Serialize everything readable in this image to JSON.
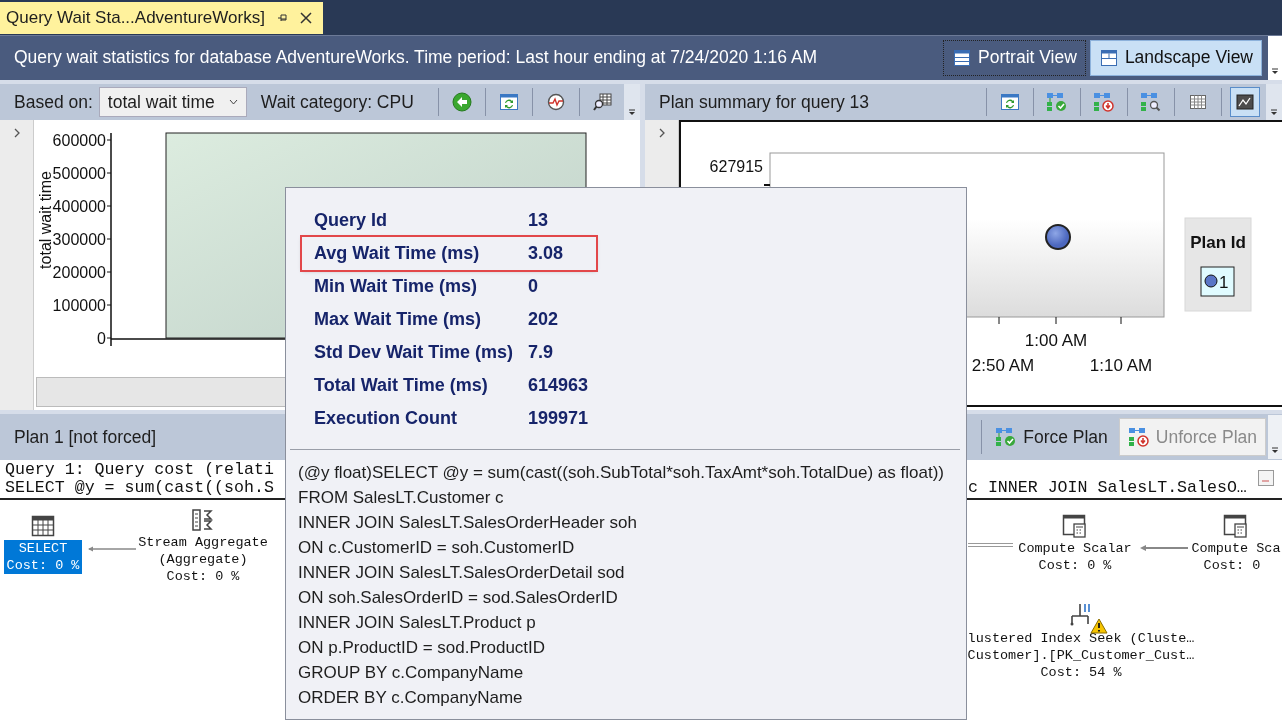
{
  "document_tab": {
    "title": "Query Wait Sta...AdventureWorks]",
    "selected": true
  },
  "header": {
    "title": "Query wait statistics for database AdventureWorks. Time period: Last hour ending at 7/24/2020 1:16 AM",
    "view_buttons": [
      {
        "label": "Portrait View",
        "kind": "portrait",
        "selected": false
      },
      {
        "label": "Landscape View",
        "kind": "landscape",
        "selected": true
      }
    ]
  },
  "wait_pane": {
    "based_on_label": "Based on:",
    "based_on_value": "total wait time",
    "category_label": "Wait category: CPU",
    "tools": [
      {
        "kind": "back",
        "selected": false
      },
      {
        "kind": "refresh",
        "selected": false
      },
      {
        "kind": "target",
        "selected": false
      },
      {
        "kind": "grid-search",
        "selected": false
      }
    ],
    "chart": {
      "ylabel": "total wait time",
      "yticks": [
        "600000",
        "500000",
        "400000",
        "300000",
        "200000",
        "100000",
        "0"
      ]
    }
  },
  "plan_summary_pane": {
    "title": "Plan summary for query 13",
    "tools": [
      {
        "kind": "refresh",
        "selected": false
      },
      {
        "kind": "force",
        "selected": false
      },
      {
        "kind": "unforce",
        "selected": false
      },
      {
        "kind": "compare",
        "selected": false
      },
      {
        "kind": "grid",
        "selected": false
      },
      {
        "kind": "chart",
        "selected": true
      }
    ],
    "chart": {
      "y_tick": "627915",
      "x_ticks": [
        "1:00 AM",
        "2:50 AM",
        "1:10 AM"
      ],
      "legend": {
        "title": "Plan Id",
        "items": [
          {
            "label": "1",
            "color": "#5a76c6"
          }
        ]
      }
    }
  },
  "plan_pane": {
    "title": "Plan 1 [not forced]",
    "buttons": [
      {
        "label": "Force Plan",
        "kind": "force",
        "disabled": false
      },
      {
        "label": "Unforce Plan",
        "kind": "unforce",
        "disabled": true
      }
    ],
    "query_text_lines": [
      "Query 1: Query cost (relati",
      "SELECT @y = sum(cast((soh.S"
    ],
    "query_text_tail": "c INNER JOIN SalesLT.SalesO…",
    "plan_nodes": [
      {
        "kind": "select",
        "lines": [
          "SELECT",
          "Cost: 0 %"
        ],
        "selected": true,
        "warning": false
      },
      {
        "kind": "aggregate",
        "lines": [
          "Stream Aggregate",
          "(Aggregate)",
          "Cost: 0 %"
        ],
        "selected": false,
        "warning": false
      },
      {
        "kind": "compute",
        "lines": [
          "Compute Scalar",
          "Cost: 0 %"
        ],
        "selected": false,
        "warning": false
      },
      {
        "kind": "compute",
        "lines": [
          "Compute Sca",
          "Cost: 0 "
        ],
        "selected": false,
        "warning": false
      },
      {
        "kind": "seek",
        "lines": [
          "lustered Index Seek (Cluste…",
          "Customer].[PK_Customer_Cust…",
          "Cost: 54 %"
        ],
        "selected": false,
        "warning": true
      }
    ]
  },
  "tooltip": {
    "stats": [
      {
        "label": "Query Id",
        "value": "13",
        "highlighted": false
      },
      {
        "label": "Avg Wait Time (ms)",
        "value": "3.08",
        "highlighted": true
      },
      {
        "label": "Min Wait Time (ms)",
        "value": "0",
        "highlighted": false
      },
      {
        "label": "Max Wait Time (ms)",
        "value": "202",
        "highlighted": false
      },
      {
        "label": "Std Dev Wait Time (ms)",
        "value": "7.9",
        "highlighted": false
      },
      {
        "label": "Total Wait Time (ms)",
        "value": "614963",
        "highlighted": false
      },
      {
        "label": "Execution Count",
        "value": "199971",
        "highlighted": false
      }
    ],
    "sql_lines": [
      "(@y float)SELECT @y = sum(cast((soh.SubTotal*soh.TaxAmt*soh.TotalDue) as float))",
      "FROM SalesLT.Customer c",
      "INNER JOIN SalesLT.SalesOrderHeader soh",
      "ON c.CustomerID = soh.CustomerID",
      "INNER JOIN SalesLT.SalesOrderDetail sod",
      "ON soh.SalesOrderID = sod.SalesOrderID",
      "INNER JOIN SalesLT.Product p",
      "ON p.ProductID = sod.ProductID",
      "GROUP BY c.CompanyName",
      "ORDER BY c.CompanyName"
    ]
  }
}
